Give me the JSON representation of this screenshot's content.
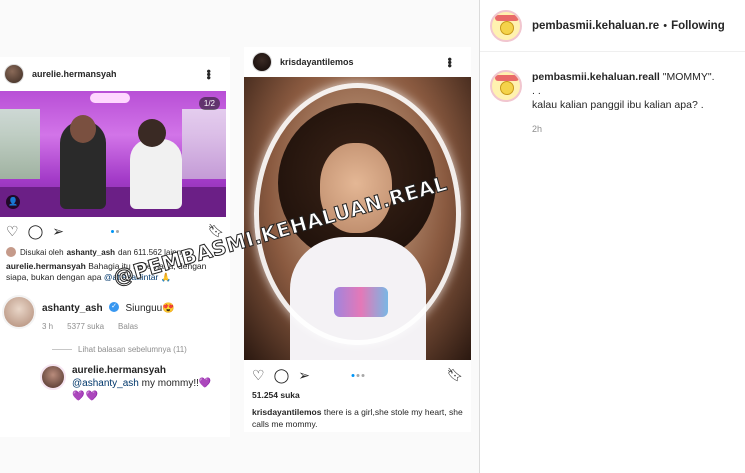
{
  "post1": {
    "username": "aurelie.hermansyah",
    "counter": "1/2",
    "likes_prefix": "Disukai oleh",
    "liked_by": "ashanty_ash",
    "likes_rest": "dan 611.562 lainnya",
    "caption_user": "aurelie.hermansyah",
    "caption_text": "Bahagia itu sederhana, dengan siapa, bukan dengan apa",
    "caption_mention": "@attahalilintar",
    "caption_emoji": "🙏",
    "comment": {
      "username": "ashanty_ash",
      "text": "Siunguu😍",
      "time": "3 h",
      "likes": "5377 suka",
      "reply_label": "Balas"
    },
    "view_previous": "Lihat balasan sebelumnya (11)",
    "reply": {
      "username": "aurelie.hermansyah",
      "mention": "@ashanty_ash",
      "text": "my mommy!!💜",
      "hearts": "💜💜"
    }
  },
  "post2": {
    "username": "krisdayantilemos",
    "likes": "51.254 suka",
    "caption_user": "krisdayantilemos",
    "caption_text": "there is a girl,she stole my heart, she calls me mommy."
  },
  "watermark": "@PEMBASMI.KEHALUAN.REAL",
  "panel": {
    "username": "pembasmii.kehaluan.re",
    "separator": "•",
    "follow_state": "Following",
    "comment_user": "pembasmii.kehaluan.reall",
    "comment_line1": "\"MOMMY\".",
    "comment_line2": ". .",
    "comment_line3": "kalau kalian panggil ibu kalian apa? .",
    "comment_time": "2h"
  },
  "icons": [
    "heart-icon",
    "comment-icon",
    "share-icon",
    "bookmark-icon",
    "more-icon",
    "user-tag-icon",
    "verified-badge-icon"
  ],
  "colors": {
    "link": "#00376b",
    "verified": "#3897f0",
    "active_dot": "#0095f6",
    "muted": "#8e8e8e"
  }
}
